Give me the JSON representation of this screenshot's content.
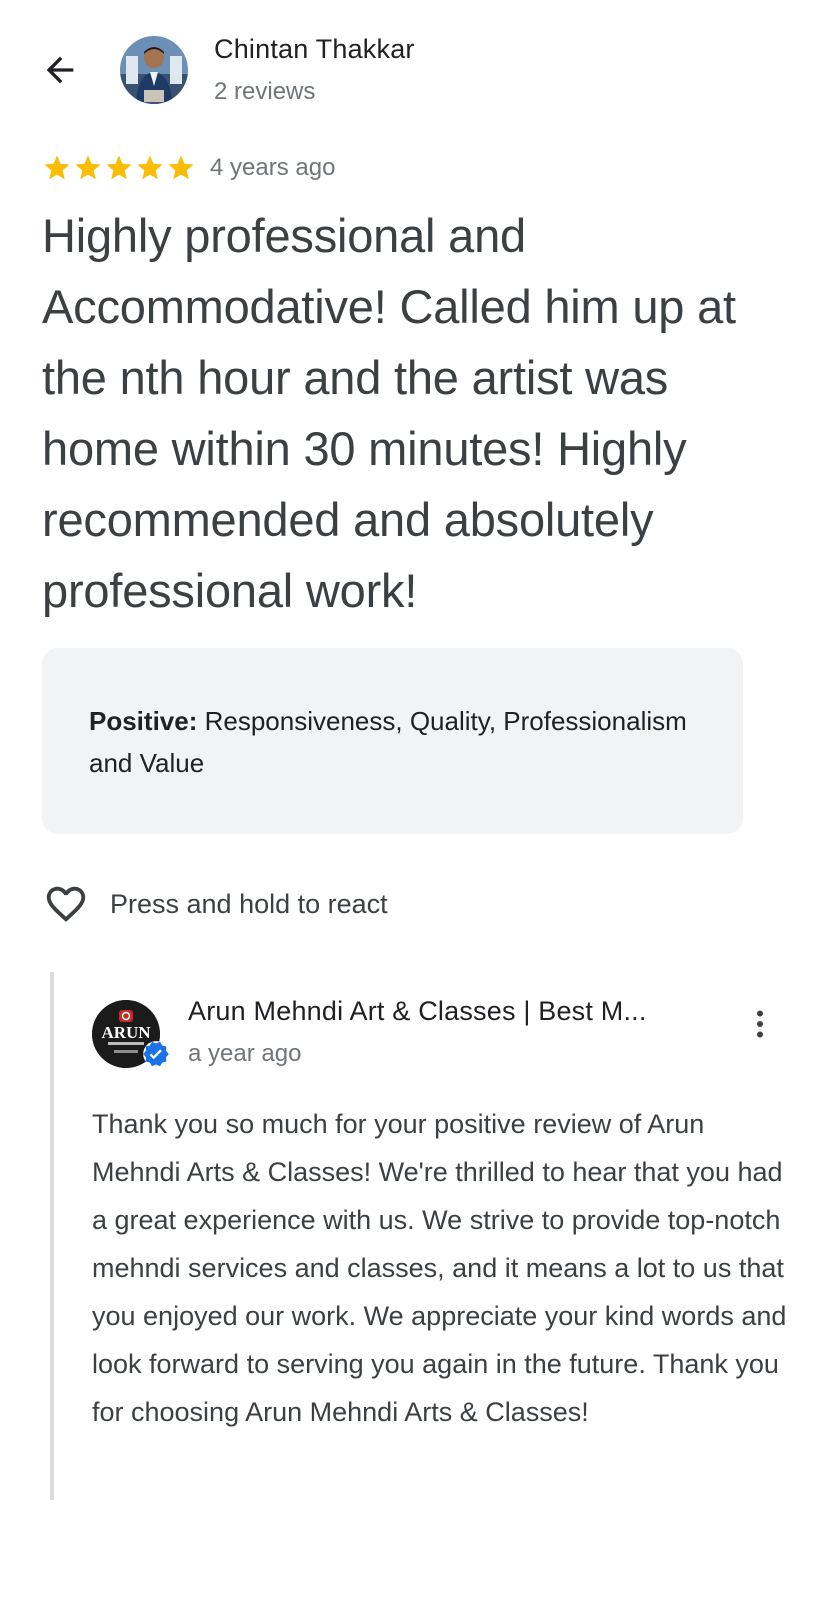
{
  "reviewer": {
    "name": "Chintan Thakkar",
    "review_count": "2 reviews"
  },
  "review": {
    "rating": 5,
    "rating_max": 5,
    "date": "4 years ago",
    "text": "Highly professional and Accommodative! Called him up at the nth hour and the artist was home within 30 minutes! Highly recommended and absolutely professional work!",
    "attributes_label": "Positive:",
    "attributes_value": "Responsiveness, Quality, Professionalism and Value"
  },
  "reactions": {
    "label": "Press and hold to react"
  },
  "owner_response": {
    "name": "Arun Mehndi Art & Classes | Best M...",
    "logo_text": "ARUN",
    "date": "a year ago",
    "text": "Thank you so much for your positive review of Arun Mehndi Arts & Classes! We're thrilled to hear that you had a great experience with us. We strive to provide top-notch mehndi services and classes, and it means a lot to us that you enjoyed our work. We appreciate your kind words and look forward to serving you again in the future. Thank you for choosing Arun Mehndi Arts & Classes!"
  },
  "icons": {
    "back": "arrow-back-icon",
    "star": "star-icon",
    "heart": "heart-outline-icon",
    "verified": "verified-badge-icon",
    "more": "more-vert-icon"
  },
  "colors": {
    "star": "#fbbc04",
    "attribute_bg": "#f1f3f4",
    "verified": "#1a73e8",
    "reply_rule": "#dadce0"
  }
}
